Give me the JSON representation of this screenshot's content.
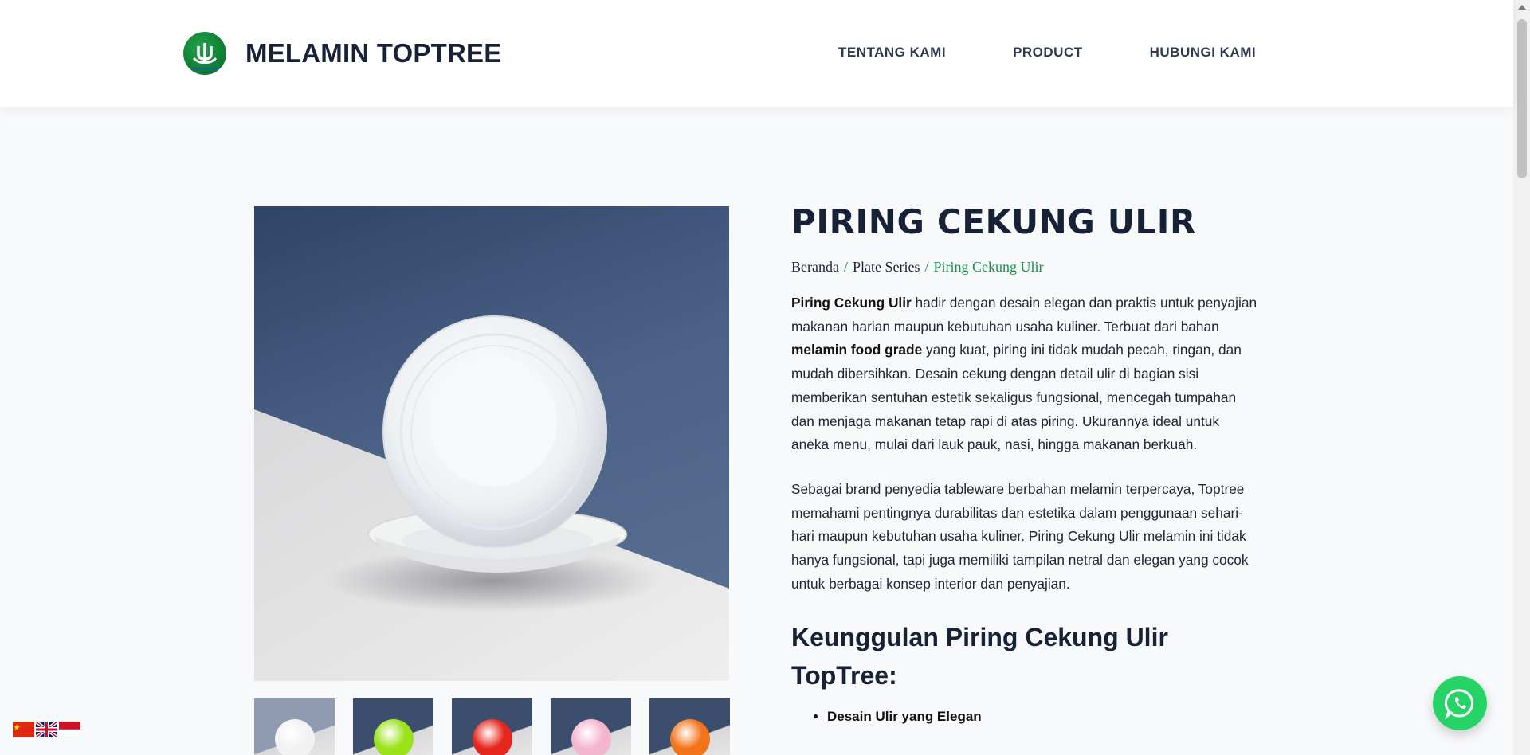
{
  "header": {
    "brand": "MELAMIN TOPTREE",
    "nav": [
      "TENTANG KAMI",
      "PRODUCT",
      "HUBUNGI KAMI"
    ]
  },
  "product": {
    "title": "PIRING CEKUNG ULIR",
    "breadcrumb": [
      "Beranda",
      "Plate Series",
      "Piring Cekung Ulir"
    ],
    "breadcrumb_sep": "/",
    "p1": {
      "b1": "Piring Cekung Ulir",
      "t1": " hadir dengan desain elegan dan praktis untuk penyajian makanan harian maupun kebutuhan usaha kuliner. Terbuat dari bahan ",
      "b2": "melamin food grade",
      "t2": " yang kuat, piring ini tidak mudah pecah, ringan, dan mudah dibersihkan. Desain cekung dengan detail ulir di bagian sisi memberikan sentuhan estetik sekaligus fungsional, mencegah tumpahan dan menjaga makanan tetap rapi di atas piring. Ukurannya ideal untuk aneka menu, mulai dari lauk pauk, nasi, hingga makanan berkuah."
    },
    "p2": "Sebagai brand penyedia tableware berbahan melamin terpercaya, Toptree memahami pentingnya durabilitas dan estetika dalam penggunaan sehari-hari maupun kebutuhan usaha kuliner. Piring Cekung Ulir melamin ini tidak hanya fungsional, tapi juga memiliki tampilan netral dan elegan yang cocok untuk berbagai konsep interior dan penyajian.",
    "advantages_heading": "Keunggulan Piring Cekung Ulir TopTree:",
    "advantages": [
      "Desain Ulir yang Elegan"
    ],
    "thumbnails": [
      {
        "color": "#f2f2f2",
        "bg": "#8f9bb0"
      },
      {
        "color": "#9be21a",
        "bg": "#3b4e6e"
      },
      {
        "color": "#e5261c",
        "bg": "#3b4e6e"
      },
      {
        "color": "#f4b6cf",
        "bg": "#3b4e6e"
      },
      {
        "color": "#f2741a",
        "bg": "#3b4e6e"
      }
    ]
  },
  "colors": {
    "accent_green": "#14914a",
    "whatsapp": "#25d366"
  },
  "icons": [
    "toptree-logo-icon",
    "whatsapp-icon",
    "flag-china-icon",
    "flag-uk-icon",
    "flag-indonesia-icon"
  ]
}
